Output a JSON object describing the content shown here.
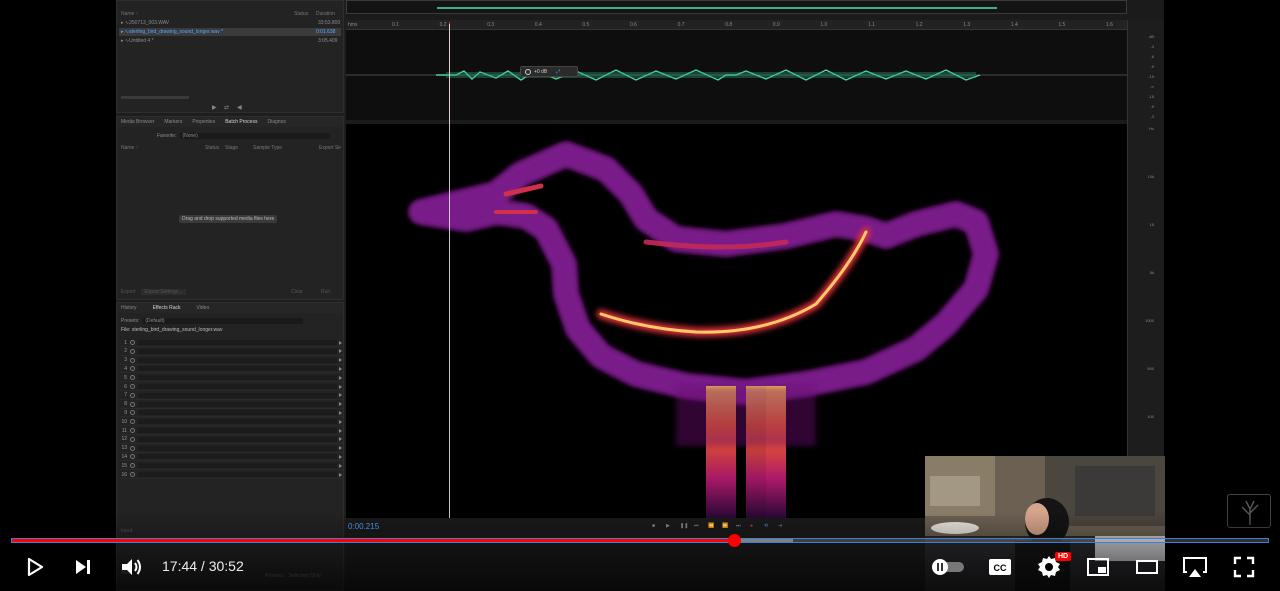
{
  "files_panel": {
    "col_name": "Name ↑",
    "col_status": "Status",
    "col_duration": "Duration",
    "files": [
      {
        "name": "250713_003.WAV",
        "duration": "33:53.800"
      },
      {
        "name": "sterling_bird_drawing_sound_longer.wav *",
        "duration": "0:01.638"
      },
      {
        "name": "Untitled 4 *",
        "duration": "3:05.409"
      }
    ]
  },
  "browser_panel": {
    "tabs": [
      "Media Browser",
      "Markers",
      "Properties",
      "Batch Process",
      "Diagnos"
    ],
    "active_tab": "Batch Process",
    "favorite_label": "Favorite:",
    "favorite_value": "(None)",
    "columns": [
      "Name ↑",
      "Status",
      "Stage",
      "Sample Type",
      "Export Se"
    ],
    "drop_hint": "Drag and drop supported media files here",
    "footer": [
      "Export",
      "Export Settings...",
      "Clear",
      "Run"
    ]
  },
  "rack_panel": {
    "tabs": [
      "History",
      "Effects Rack",
      "Video"
    ],
    "active_tab": "Effects Rack",
    "presets_label": "Presets:",
    "presets_value": "(Default)",
    "file_label": "File: sterling_bird_drawing_sound_longer.wav",
    "slots": [
      "1",
      "2",
      "3",
      "4",
      "5",
      "6",
      "7",
      "8",
      "9",
      "10",
      "11",
      "12",
      "13",
      "14",
      "15",
      "16"
    ],
    "input_label": "Input:",
    "process_label": "Process:",
    "process_value": "Selection Only",
    "mix_label": "Mix:"
  },
  "editor": {
    "ruler_unit": "hms",
    "ruler_ticks": [
      "0.1",
      "0.2",
      "0.3",
      "0.4",
      "0.5",
      "0.6",
      "0.7",
      "0.8",
      "0.9",
      "1.0",
      "1.1",
      "1.2",
      "1.3",
      "1.4",
      "1.5",
      "1.6"
    ],
    "level_value": "+0 dB",
    "timecode": "0:00.215",
    "amp_scale": [
      "dB",
      "-3",
      "-6",
      "-9",
      "-15",
      "-∞",
      "-15",
      "-9",
      "-3"
    ],
    "freq_scale": [
      "Hz",
      "10k",
      "15",
      "5k",
      "1000",
      "500",
      "100"
    ]
  },
  "player": {
    "time_current": "17:44",
    "time_separator": " / ",
    "time_total": "30:52",
    "progress_fraction": 0.575,
    "buffer_fraction": 0.622,
    "hd_badge": "HD",
    "accent": "#ff0000"
  }
}
